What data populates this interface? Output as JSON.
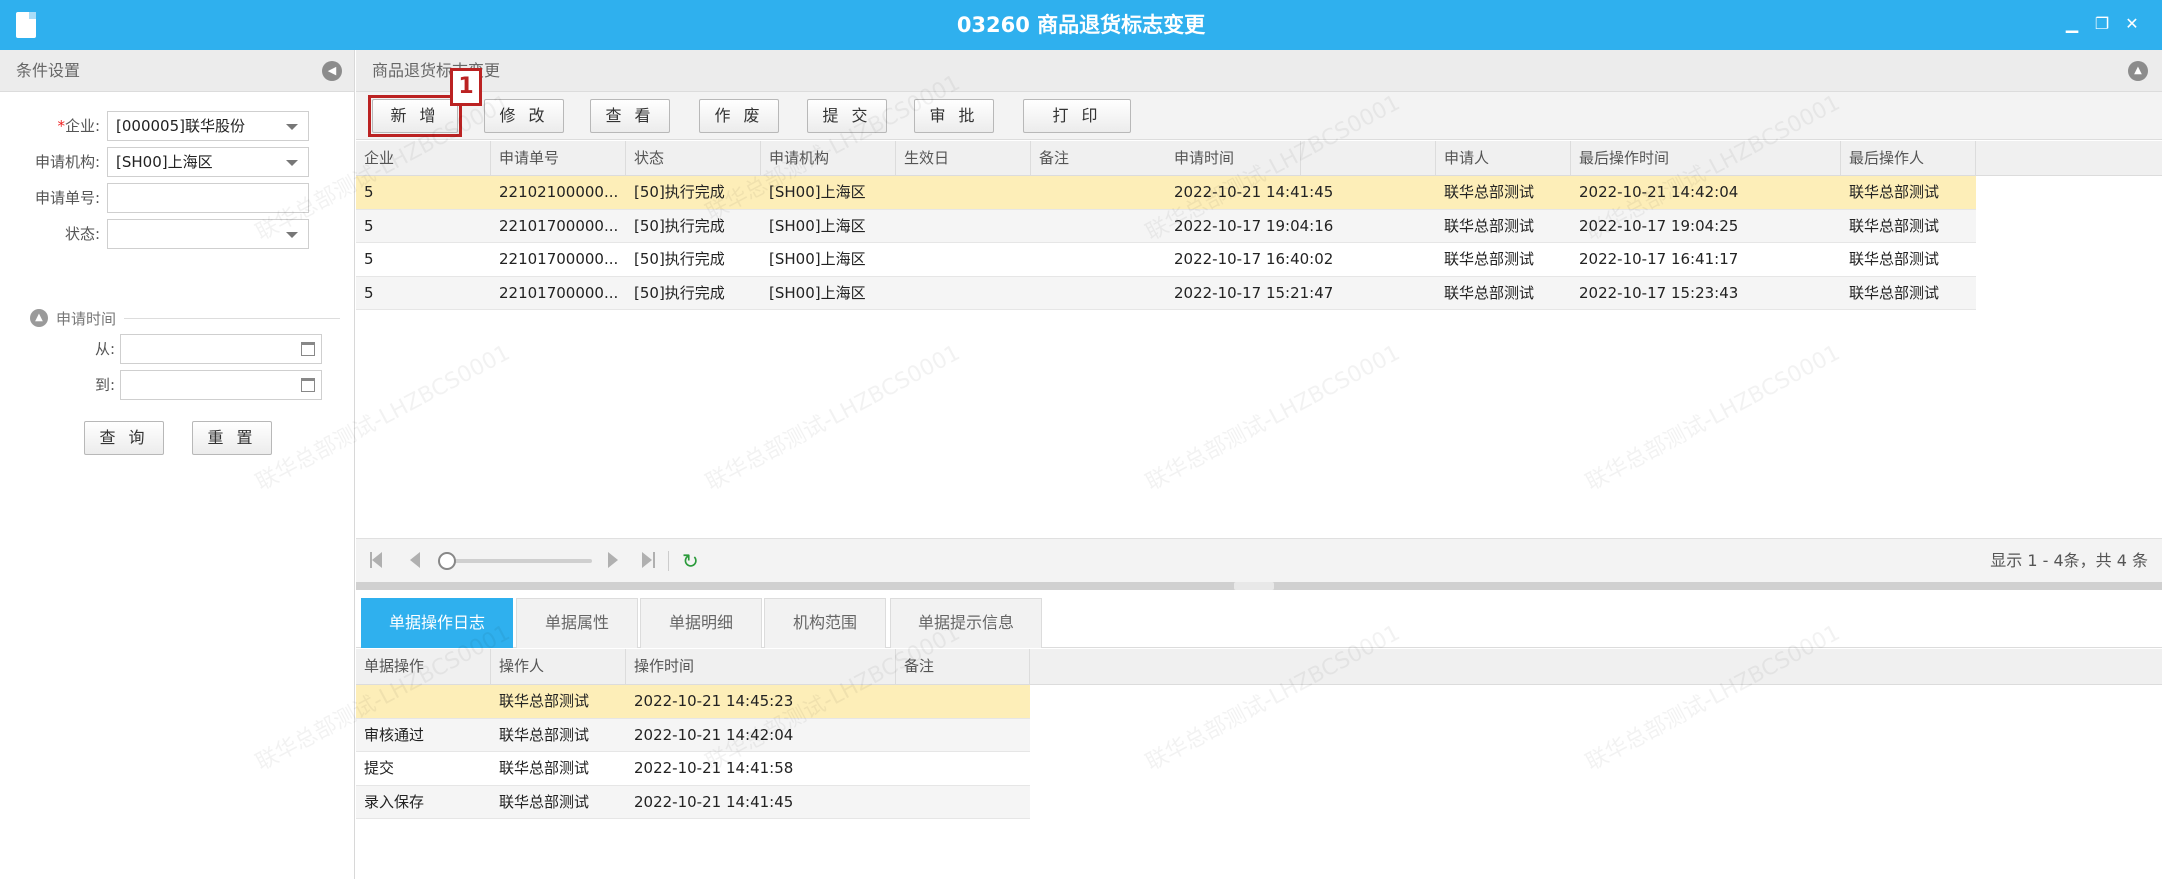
{
  "window": {
    "title": "03260 商品退货标志变更",
    "controls": [
      "minimize-icon",
      "restore-icon",
      "close-icon"
    ]
  },
  "left_panel": {
    "title": "条件设置",
    "fields": {
      "company": {
        "label": "企业:",
        "required_mark": "*",
        "value": "[000005]联华股份"
      },
      "org": {
        "label": "申请机构:",
        "value": "[SH00]上海区"
      },
      "doc_no": {
        "label": "申请单号:",
        "value": ""
      },
      "status": {
        "label": "状态:",
        "value": ""
      }
    },
    "date_section": {
      "title": "申请时间",
      "from_label": "从:",
      "to_label": "到:",
      "from_value": "",
      "to_value": ""
    },
    "query_button": "查 询",
    "reset_button": "重 置"
  },
  "main": {
    "breadcrumb": "商品退货标志变更",
    "toolbar": {
      "buttons": [
        "新 增",
        "修 改",
        "查 看",
        "作 废",
        "提 交",
        "审 批",
        "打 印"
      ],
      "highlight_badge": "1"
    },
    "grid": {
      "columns": [
        "企业",
        "申请单号",
        "状态",
        "申请机构",
        "生效日",
        "备注",
        "申请时间",
        "申请人",
        "最后操作时间",
        "最后操作人"
      ],
      "rows": [
        [
          "5",
          "22102100000...",
          "[50]执行完成",
          "[SH00]上海区",
          "",
          "",
          "2022-10-21 14:41:45",
          "联华总部测试",
          "2022-10-21 14:42:04",
          "联华总部测试"
        ],
        [
          "5",
          "22101700000...",
          "[50]执行完成",
          "[SH00]上海区",
          "",
          "",
          "2022-10-17 19:04:16",
          "联华总部测试",
          "2022-10-17 19:04:25",
          "联华总部测试"
        ],
        [
          "5",
          "22101700000...",
          "[50]执行完成",
          "[SH00]上海区",
          "",
          "",
          "2022-10-17 16:40:02",
          "联华总部测试",
          "2022-10-17 16:41:17",
          "联华总部测试"
        ],
        [
          "5",
          "22101700000...",
          "[50]执行完成",
          "[SH00]上海区",
          "",
          "",
          "2022-10-17 15:21:47",
          "联华总部测试",
          "2022-10-17 15:23:43",
          "联华总部测试"
        ]
      ]
    },
    "pager": {
      "info": "显示 1 - 4条，共 4 条",
      "slider_position": 0
    },
    "tabs": [
      "单据操作日志",
      "单据属性",
      "单据明细",
      "机构范围",
      "单据提示信息"
    ],
    "active_tab": 0,
    "log_grid": {
      "columns": [
        "单据操作",
        "操作人",
        "操作时间",
        "备注"
      ],
      "rows": [
        [
          "",
          "联华总部测试",
          "2022-10-21 14:45:23",
          ""
        ],
        [
          "审核通过",
          "联华总部测试",
          "2022-10-21 14:42:04",
          ""
        ],
        [
          "提交",
          "联华总部测试",
          "2022-10-21 14:41:58",
          ""
        ],
        [
          "录入保存",
          "联华总部测试",
          "2022-10-21 14:41:45",
          ""
        ]
      ]
    }
  },
  "watermark": "联华总部测试-LHZBCS0001",
  "colors": {
    "accent": "#2fb0ee",
    "selected_row": "#fdeeb8",
    "highlight": "#b22222",
    "refresh_icon": "#2a9a3a"
  }
}
